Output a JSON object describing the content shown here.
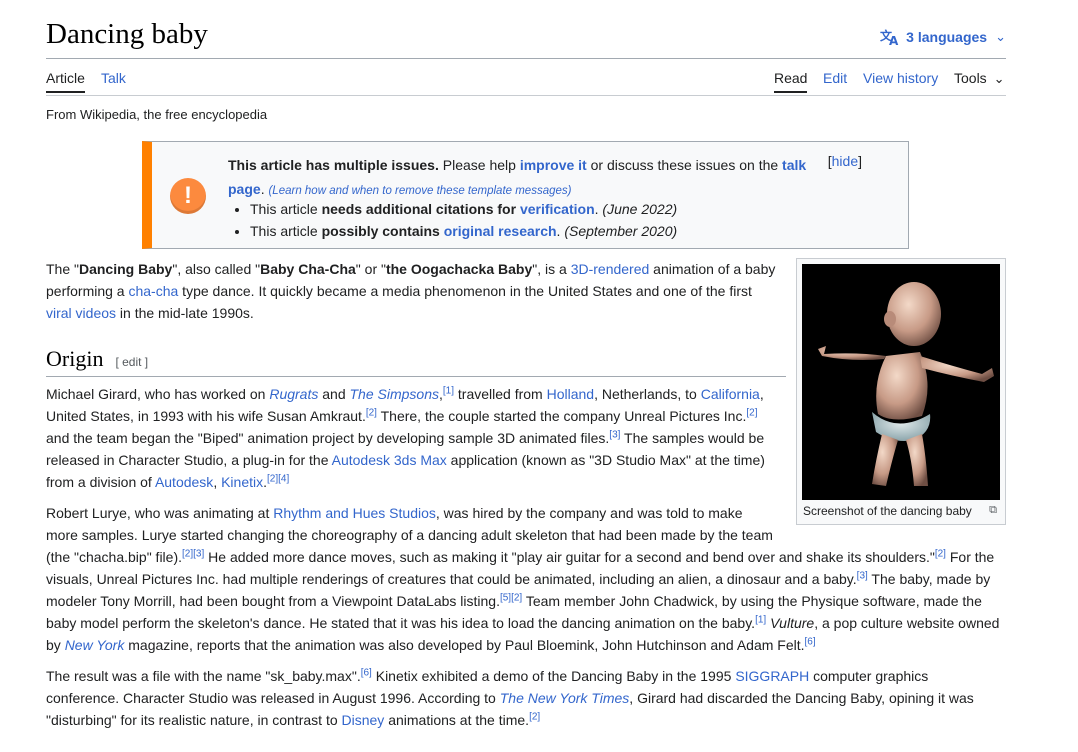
{
  "page": {
    "title": "Dancing baby",
    "languages": "3 languages",
    "tabs": {
      "article": "Article",
      "talk": "Talk",
      "read": "Read",
      "edit": "Edit",
      "view_history": "View history",
      "tools": "Tools"
    },
    "from": "From Wikipedia, the free encyclopedia"
  },
  "ambox": {
    "bold": "This article has multiple issues.",
    "t1": " Please help ",
    "improve": "improve it",
    "t2": " or discuss these issues on the ",
    "talk_page": "talk page",
    "t3": ". ",
    "learn": "(Learn how and when to remove these template messages)",
    "hide": "hide",
    "issues": [
      {
        "pre": "This article ",
        "bold": "needs additional citations for ",
        "link": "verification",
        "post": ". ",
        "date": "(June 2022)"
      },
      {
        "pre": "This article ",
        "bold": "possibly contains ",
        "link": "original research",
        "post": ". ",
        "date": "(September 2020)"
      }
    ]
  },
  "intro": {
    "a": "The \"",
    "b1": "Dancing Baby",
    "c": "\", also called \"",
    "b2": "Baby Cha-Cha",
    "d": "\" or \"",
    "b3": "the Oogachacka Baby",
    "e": "\", is a ",
    "l1": "3D-rendered",
    "f": " animation of a baby",
    "g": "performing a ",
    "l2": "cha-cha",
    "h": " type dance. It quickly became a media phenomenon in the United States and one of the first",
    "l3": "viral videos",
    "i": " in the mid-late 1990s."
  },
  "section": {
    "title": "Origin",
    "edit": "[ edit ]"
  },
  "figure": {
    "caption": "Screenshot of the dancing baby",
    "icon": "enlarge-icon"
  },
  "origin": {
    "p1": {
      "l1_a": "Michael Girard, who has worked on ",
      "rugrats": "Rugrats",
      "l1_b": " and ",
      "simpsons": "The Simpsons",
      "l1_c": ",",
      "ref1": "[1]",
      "l1_d": " travelled from ",
      "holland": "Holland",
      "l1_e": ", Netherlands, to ",
      "california": "California",
      "l1_f": ",",
      "l2_a": "United States, in 1993 with his wife Susan Amkraut.",
      "ref2": "[2]",
      "l2_b": " There, the couple started the company Unreal Pictures Inc.",
      "ref2b": "[2]",
      "l3_a": "and the team began the \"Biped\" animation project by developing sample 3D animated files.",
      "ref3": "[3]",
      "l3_b": " The samples would be",
      "l4_a": "released in Character Studio, a plug-in for the ",
      "autodesk3ds": "Autodesk 3ds Max",
      "l4_b": " application (known as \"3D Studio Max\" at the time)",
      "l5_a": "from a division of ",
      "autodesk": "Autodesk",
      "l5_b": ", ",
      "kinetix": "Kinetix",
      "l5_c": ".",
      "ref24": "[2][4]"
    },
    "p2": {
      "l1_a": "Robert Lurye, who was animating at ",
      "rhythm": "Rhythm and Hues Studios",
      "l1_b": ", was hired by the company and was told to make",
      "l2": "more samples. Lurye started changing the choreography of a dancing adult skeleton that had been made by the team",
      "l3_a": "(the \"chacha.bip\" file).",
      "ref23": "[2][3]",
      "l3_b": " He added more dance moves, such as making it \"play air guitar for a second and bend over and shake its shoulders.\"",
      "ref2": "[2]",
      "l3_c": " For the",
      "l4_a": "visuals, Unreal Pictures Inc. had multiple renderings of creatures that could be animated, including an alien, a dinosaur and a baby.",
      "ref3": "[3]",
      "l4_b": " The baby, made by",
      "l5_a": "modeler Tony Morrill, had been bought from a Viewpoint DataLabs listing.",
      "ref52": "[5][2]",
      "l5_b": " Team member John Chadwick, by using the Physique software, made the",
      "l6_a": "baby model perform the skeleton's dance. He stated that it was his idea to load the dancing animation on the baby.",
      "ref1": "[1]",
      "l6_b": " ",
      "vulture": "Vulture",
      "l6_c": ", a pop culture website owned",
      "l7_a": "by ",
      "nym": "New York",
      "l7_b": " magazine, reports that the animation was also developed by Paul Bloemink, John Hutchinson and Adam Felt.",
      "ref6": "[6]"
    },
    "p3": {
      "l1_a": "The result was a file with the name \"sk_baby.max\".",
      "ref6": "[6]",
      "l1_b": " Kinetix exhibited a demo of the Dancing Baby in the 1995 ",
      "siggraph": "SIGGRAPH",
      "l1_c": " computer graphics",
      "l2_a": "conference. Character Studio was released in August 1996. According to ",
      "nyt": "The New York Times",
      "l2_b": ", Girard had discarded the Dancing Baby, opining it was",
      "l3_a": "\"disturbing\" for its realistic nature, in contrast to ",
      "disney": "Disney",
      "l3_b": " animations at the time.",
      "ref2": "[2]"
    }
  }
}
